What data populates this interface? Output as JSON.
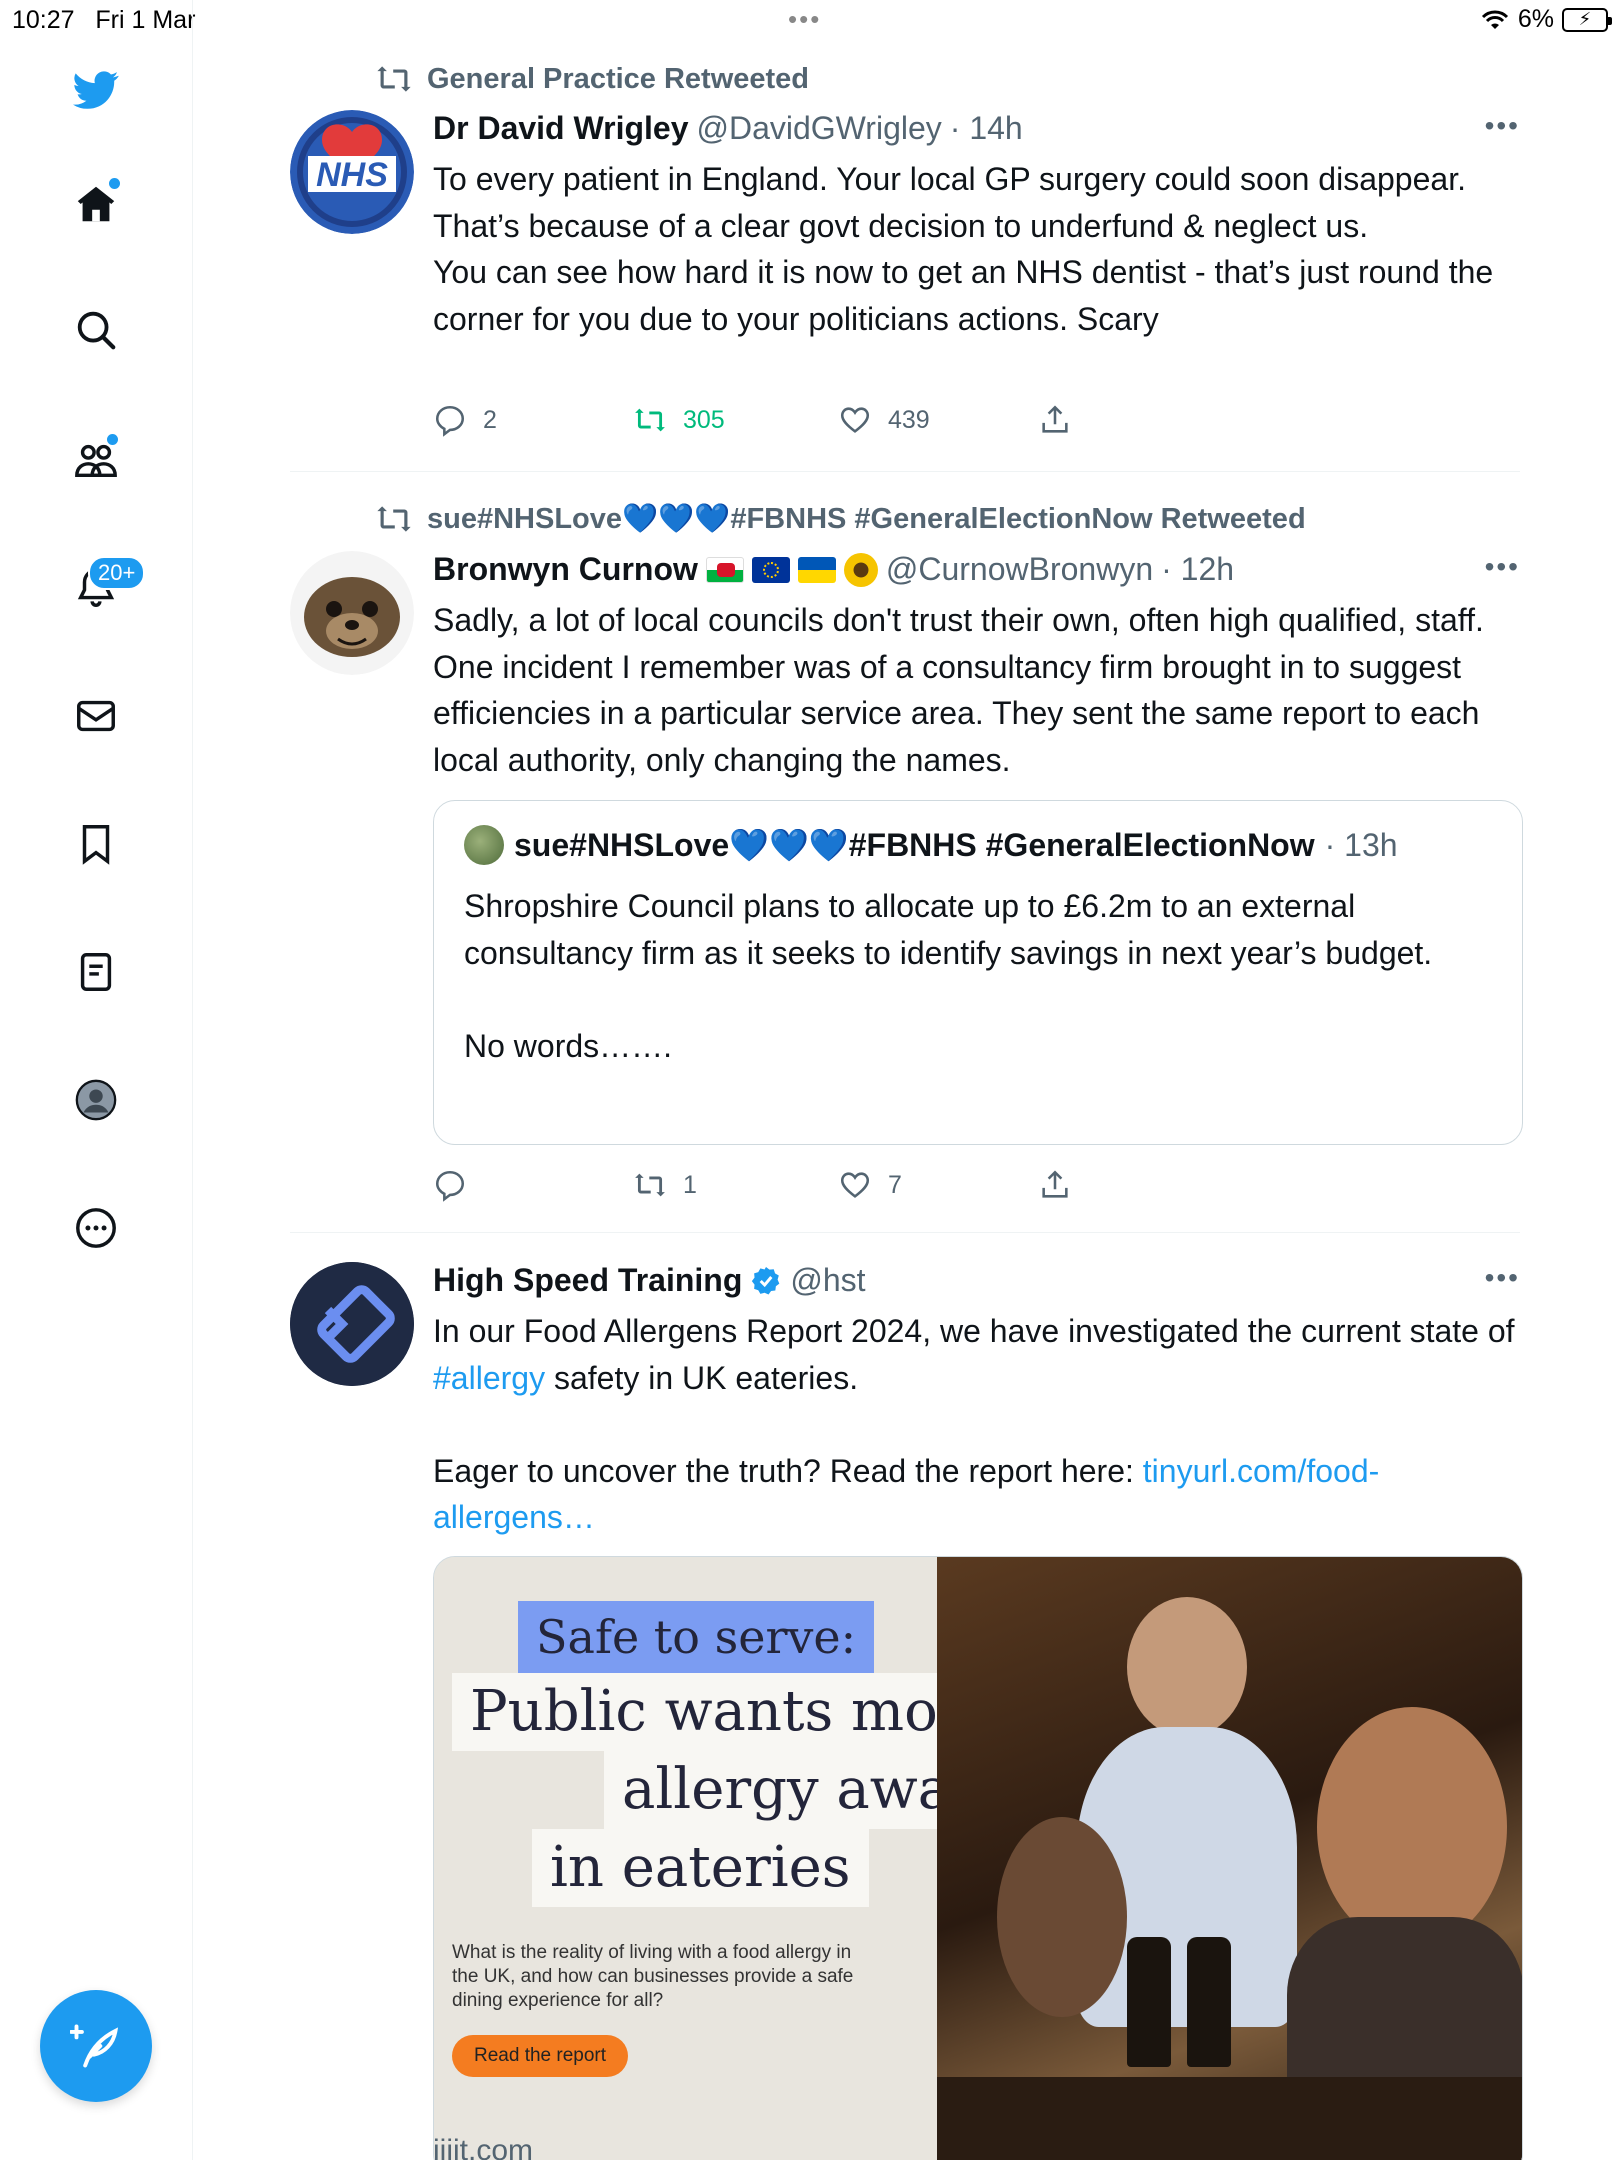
{
  "status_bar": {
    "time": "10:27",
    "date": "Fri 1 Mar",
    "dots": "•••",
    "battery": "6%"
  },
  "sidebar": {
    "notifications_badge": "20+",
    "items": [
      "home-icon",
      "search-icon",
      "communities-icon",
      "notifications-icon",
      "messages-icon",
      "bookmarks-icon",
      "lists-icon",
      "profile-icon",
      "more-icon"
    ]
  },
  "tweets": [
    {
      "retweeted_by": "General Practice Retweeted",
      "display_name": "Dr David Wrigley",
      "handle": "@DavidGWrigley",
      "time": "· 14h",
      "avatar_text": "NHS",
      "text": "To every patient in England. Your local GP surgery could soon disappear.\nThat’s because of a clear govt decision to underfund & neglect us.\nYou can see how hard it is now to get an NHS dentist - that’s just round the corner for you due to your politicians actions. Scary",
      "replies": "2",
      "retweets": "305",
      "likes": "439"
    },
    {
      "retweeted_by": "sue#NHSLove💙💙💙#FBNHS #GeneralElectionNow Retweeted",
      "display_name": "Bronwyn Curnow",
      "handle": "@CurnowBronwyn",
      "time": "· 12h",
      "text": "Sadly, a lot of local councils don't trust their own, often high qualified, staff. One incident I remember was of a consultancy firm brought in to suggest efficiencies in a particular service area. They sent the same report to each local authority, only changing the names.",
      "quote": {
        "display_name": "sue#NHSLove💙💙💙#FBNHS #GeneralElectionNow",
        "time": "· 13h",
        "text": "Shropshire Council plans to allocate up to £6.2m to an external consultancy firm as it seeks to identify savings in next year’s budget.\n\nNo words……."
      },
      "replies": "",
      "retweets": "1",
      "likes": "7"
    },
    {
      "display_name": "High Speed Training",
      "handle": "@hst",
      "text_part1": "In our Food Allergens Report 2024, we have investigated the current state of ",
      "hashtag": "#allergy",
      "text_part2": " safety in UK eateries.\n\nEager to uncover the truth? Read the report here: ",
      "link": "tinyurl.com/food-allergens…",
      "card": {
        "line1": "Safe to serve:",
        "line2": "Public wants more",
        "line3": "allergy awareness",
        "line4": "in eateries",
        "description": "What is the reality of living with a food allergy in the UK, and how can businesses provide a safe dining experience for all?",
        "button": "Read the report",
        "domain": "iiiit.com"
      }
    }
  ],
  "colors": {
    "accent": "#1d9bf0",
    "retweet_green": "#00ba7c",
    "secondary_text": "#536471"
  }
}
